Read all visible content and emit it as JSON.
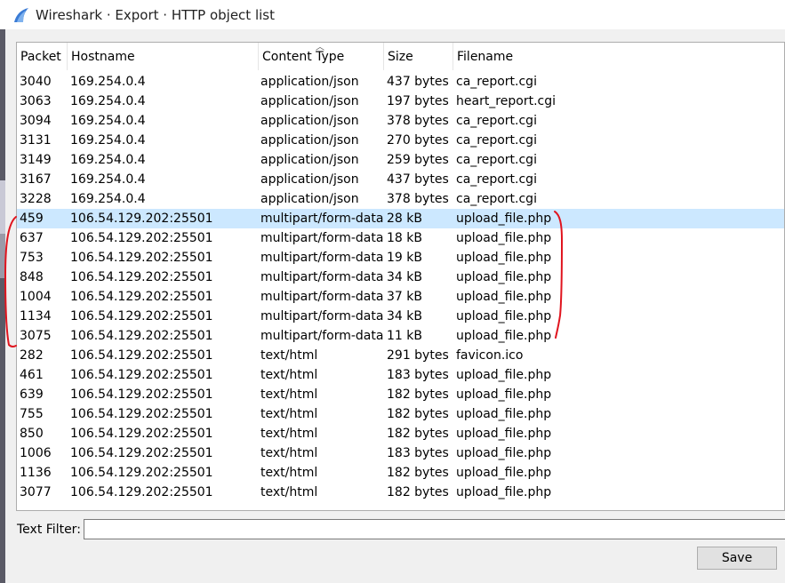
{
  "window": {
    "title": "Wireshark · Export · HTTP object list",
    "icon": "wireshark-fin-icon",
    "accent": "#3a7bd5"
  },
  "table": {
    "columns": [
      "Packet",
      "Hostname",
      "Content Type",
      "Size",
      "Filename"
    ],
    "sorted_column": "Content Type",
    "selected_row_color": "#cce8ff",
    "rows": [
      {
        "packet": "3040",
        "hostname": "169.254.0.4",
        "content_type": "application/json",
        "size": "437 bytes",
        "filename": "ca_report.cgi"
      },
      {
        "packet": "3063",
        "hostname": "169.254.0.4",
        "content_type": "application/json",
        "size": "197 bytes",
        "filename": "heart_report.cgi"
      },
      {
        "packet": "3094",
        "hostname": "169.254.0.4",
        "content_type": "application/json",
        "size": "378 bytes",
        "filename": "ca_report.cgi"
      },
      {
        "packet": "3131",
        "hostname": "169.254.0.4",
        "content_type": "application/json",
        "size": "270 bytes",
        "filename": "ca_report.cgi"
      },
      {
        "packet": "3149",
        "hostname": "169.254.0.4",
        "content_type": "application/json",
        "size": "259 bytes",
        "filename": "ca_report.cgi"
      },
      {
        "packet": "3167",
        "hostname": "169.254.0.4",
        "content_type": "application/json",
        "size": "437 bytes",
        "filename": "ca_report.cgi"
      },
      {
        "packet": "3228",
        "hostname": "169.254.0.4",
        "content_type": "application/json",
        "size": "378 bytes",
        "filename": "ca_report.cgi"
      },
      {
        "packet": "459",
        "hostname": "106.54.129.202:25501",
        "content_type": "multipart/form-data",
        "size": "28 kB",
        "filename": "upload_file.php",
        "selected": true
      },
      {
        "packet": "637",
        "hostname": "106.54.129.202:25501",
        "content_type": "multipart/form-data",
        "size": "18 kB",
        "filename": "upload_file.php"
      },
      {
        "packet": "753",
        "hostname": "106.54.129.202:25501",
        "content_type": "multipart/form-data",
        "size": "19 kB",
        "filename": "upload_file.php"
      },
      {
        "packet": "848",
        "hostname": "106.54.129.202:25501",
        "content_type": "multipart/form-data",
        "size": "34 kB",
        "filename": "upload_file.php"
      },
      {
        "packet": "1004",
        "hostname": "106.54.129.202:25501",
        "content_type": "multipart/form-data",
        "size": "37 kB",
        "filename": "upload_file.php"
      },
      {
        "packet": "1134",
        "hostname": "106.54.129.202:25501",
        "content_type": "multipart/form-data",
        "size": "34 kB",
        "filename": "upload_file.php"
      },
      {
        "packet": "3075",
        "hostname": "106.54.129.202:25501",
        "content_type": "multipart/form-data",
        "size": "11 kB",
        "filename": "upload_file.php"
      },
      {
        "packet": "282",
        "hostname": "106.54.129.202:25501",
        "content_type": "text/html",
        "size": "291 bytes",
        "filename": "favicon.ico"
      },
      {
        "packet": "461",
        "hostname": "106.54.129.202:25501",
        "content_type": "text/html",
        "size": "183 bytes",
        "filename": "upload_file.php"
      },
      {
        "packet": "639",
        "hostname": "106.54.129.202:25501",
        "content_type": "text/html",
        "size": "182 bytes",
        "filename": "upload_file.php"
      },
      {
        "packet": "755",
        "hostname": "106.54.129.202:25501",
        "content_type": "text/html",
        "size": "182 bytes",
        "filename": "upload_file.php"
      },
      {
        "packet": "850",
        "hostname": "106.54.129.202:25501",
        "content_type": "text/html",
        "size": "182 bytes",
        "filename": "upload_file.php"
      },
      {
        "packet": "1006",
        "hostname": "106.54.129.202:25501",
        "content_type": "text/html",
        "size": "183 bytes",
        "filename": "upload_file.php"
      },
      {
        "packet": "1136",
        "hostname": "106.54.129.202:25501",
        "content_type": "text/html",
        "size": "182 bytes",
        "filename": "upload_file.php"
      },
      {
        "packet": "3077",
        "hostname": "106.54.129.202:25501",
        "content_type": "text/html",
        "size": "182 bytes",
        "filename": "upload_file.php"
      }
    ]
  },
  "filter": {
    "label": "Text Filter:",
    "value": "",
    "placeholder": ""
  },
  "buttons": {
    "save_label": "Save"
  },
  "annotation": {
    "color": "#e0141e"
  }
}
